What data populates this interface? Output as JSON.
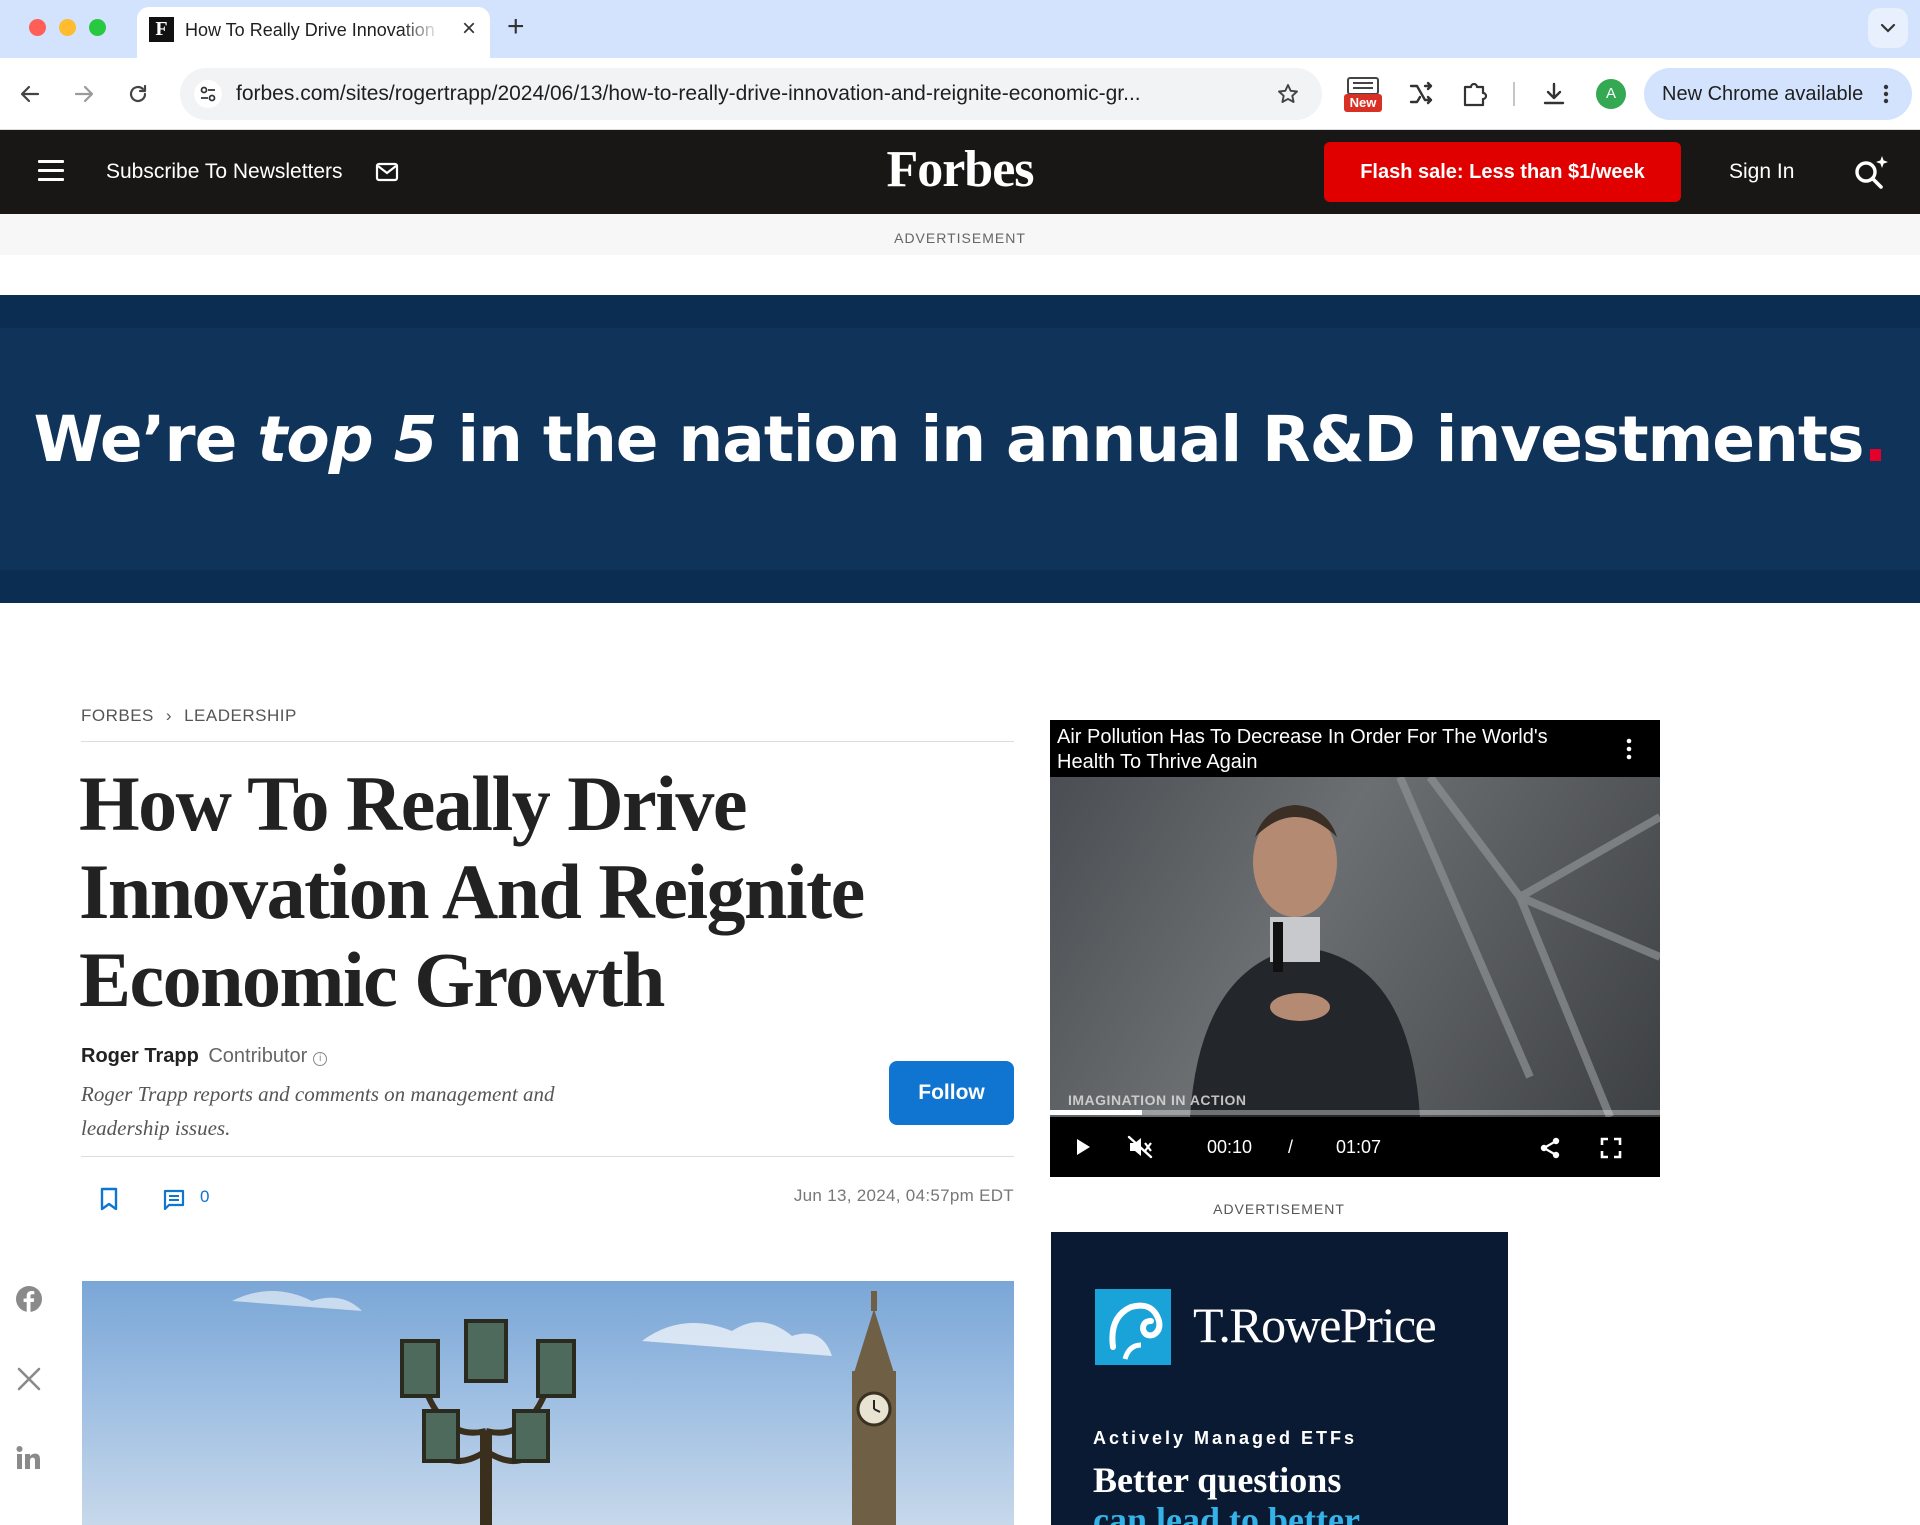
{
  "browser": {
    "tab_title": "How To Really Drive Innovation And Reignite Economic Growth",
    "tab_favicon": "F",
    "url": "forbes.com/sites/rogertrapp/2024/06/13/how-to-really-drive-innovation-and-reignite-economic-gr...",
    "extension_badge": "New",
    "profile_initial": "A",
    "update_label": "New Chrome available"
  },
  "header": {
    "newsletter_label": "Subscribe To Newsletters",
    "logo": "Forbes",
    "flash_sale_label": "Flash sale: Less than $1/week",
    "sign_in_label": "Sign In"
  },
  "ad_top": {
    "label": "ADVERTISEMENT",
    "headline_pre": "We’re ",
    "headline_em": "top 5",
    "headline_post": " in the nation in annual R&D investments",
    "headline_dot": "."
  },
  "article": {
    "breadcrumb": [
      "FORBES",
      "LEADERSHIP"
    ],
    "headline": "How To Really Drive Innovation And Reignite Economic Growth",
    "author_name": "Roger Trapp",
    "author_role": "Contributor",
    "author_bio": "Roger Trapp reports and comments on management and leadership issues.",
    "follow_label": "Follow",
    "comment_count": "0",
    "date": "Jun 13, 2024, 04:57pm EDT"
  },
  "video": {
    "title": "Air Pollution Has To Decrease In Order For The World's Health To Thrive Again",
    "caption": "IMAGINATION IN ACTION",
    "current_time": "00:10",
    "time_separator": "/",
    "duration": "01:07",
    "progress_fraction": 0.15
  },
  "ad_side": {
    "label": "ADVERTISEMENT",
    "brand": "T.RowePrice",
    "kicker": "Actively Managed ETFs",
    "line1": "Better questions",
    "line2": "can lead to better"
  },
  "colors": {
    "header_bg": "#181716",
    "flash_sale": "#e00000",
    "follow": "#0f75d1",
    "ad_navy": "#10335a",
    "ad_dot": "#e4002b"
  }
}
